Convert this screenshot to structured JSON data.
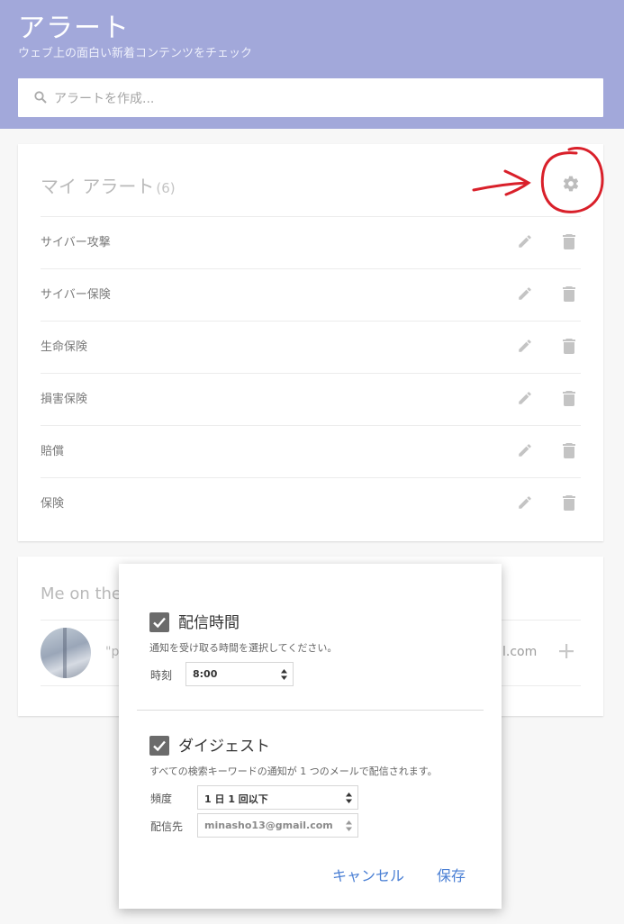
{
  "header": {
    "title": "アラート",
    "subtitle": "ウェブ上の面白い新着コンテンツをチェック"
  },
  "search": {
    "placeholder": "アラートを作成..."
  },
  "my_alerts": {
    "heading": "マイ アラート",
    "count": "(6)",
    "items": [
      {
        "label": "サイバー攻撃"
      },
      {
        "label": "サイバー保険"
      },
      {
        "label": "生命保険"
      },
      {
        "label": "損害保険"
      },
      {
        "label": "賠償"
      },
      {
        "label": "保険"
      }
    ]
  },
  "me_on_web": {
    "heading": "Me on the",
    "left_text": "\"p",
    "right_text": "l.com"
  },
  "popup": {
    "delivery_time": {
      "title": "配信時間",
      "description": "通知を受け取る時間を選択してください。",
      "time_label": "時刻",
      "time_value": "8:00",
      "checked": true
    },
    "digest": {
      "title": "ダイジェスト",
      "description": "すべての検索キーワードの通知が 1 つのメールで配信されます。",
      "frequency_label": "頻度",
      "frequency_value": "1 日 1 回以下",
      "deliver_to_label": "配信先",
      "deliver_to_value": "minasho13@gmail.com",
      "checked": true
    },
    "cancel_label": "キャンセル",
    "save_label": "保存"
  },
  "colors": {
    "header_bg": "#a2a8da",
    "link_blue": "#4a7fd4",
    "annotation_red": "#d9202a"
  },
  "icons": [
    "search-icon",
    "gear-icon",
    "pencil-icon",
    "trash-icon",
    "plus-icon",
    "checkbox-check-icon",
    "select-arrows-icon"
  ]
}
